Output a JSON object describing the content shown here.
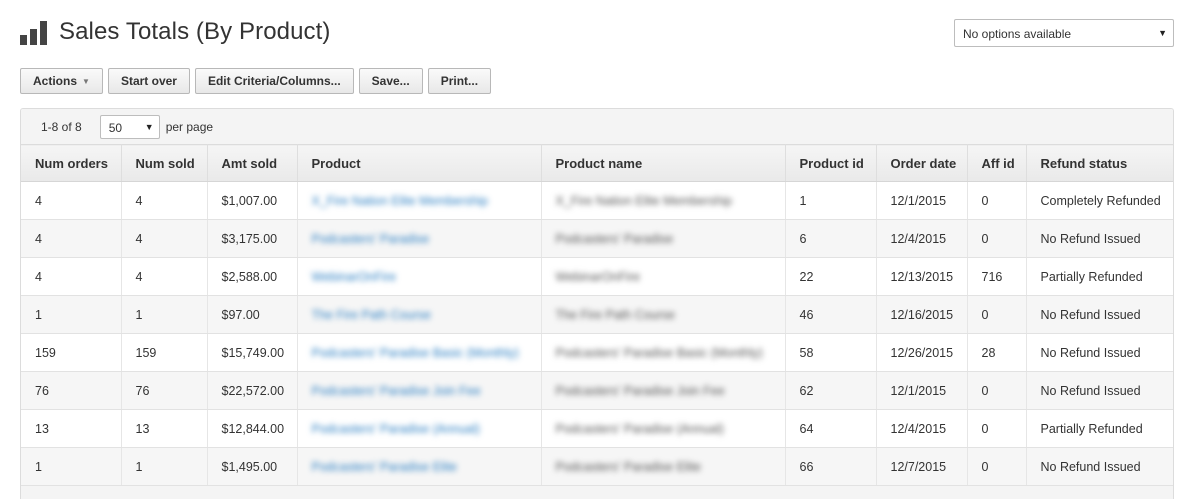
{
  "page": {
    "title": "Sales Totals (By Product)"
  },
  "header_select": {
    "value": "No options available"
  },
  "toolbar": {
    "actions": "Actions",
    "start_over": "Start over",
    "edit": "Edit Criteria/Columns...",
    "save": "Save...",
    "print": "Print..."
  },
  "pager": {
    "range": "1-8 of 8",
    "per_page_value": "50",
    "per_page_label": "per page"
  },
  "table": {
    "columns": [
      "Num orders",
      "Num sold",
      "Amt sold",
      "Product",
      "Product name",
      "Product id",
      "Order date",
      "Aff id",
      "Refund status"
    ],
    "rows": [
      [
        "4",
        "4",
        "$1,007.00",
        "X_Fire Nation Elite Membership",
        "X_Fire Nation Elite Membership",
        "1",
        "12/1/2015",
        "0",
        "Completely Refunded"
      ],
      [
        "4",
        "4",
        "$3,175.00",
        "Podcasters' Paradise",
        "Podcasters' Paradise",
        "6",
        "12/4/2015",
        "0",
        "No Refund Issued"
      ],
      [
        "4",
        "4",
        "$2,588.00",
        "WebinarOnFire",
        "WebinarOnFire",
        "22",
        "12/13/2015",
        "716",
        "Partially Refunded"
      ],
      [
        "1",
        "1",
        "$97.00",
        "The Fire Path Course",
        "The Fire Path Course",
        "46",
        "12/16/2015",
        "0",
        "No Refund Issued"
      ],
      [
        "159",
        "159",
        "$15,749.00",
        "Podcasters' Paradise Basic (Monthly)",
        "Podcasters' Paradise Basic (Monthly)",
        "58",
        "12/26/2015",
        "28",
        "No Refund Issued"
      ],
      [
        "76",
        "76",
        "$22,572.00",
        "Podcasters' Paradise Join Fee",
        "Podcasters' Paradise Join Fee",
        "62",
        "12/1/2015",
        "0",
        "No Refund Issued"
      ],
      [
        "13",
        "13",
        "$12,844.00",
        "Podcasters' Paradise (Annual)",
        "Podcasters' Paradise (Annual)",
        "64",
        "12/4/2015",
        "0",
        "Partially Refunded"
      ],
      [
        "1",
        "1",
        "$1,495.00",
        "Podcasters' Paradise Elite",
        "Podcasters' Paradise Elite",
        "66",
        "12/7/2015",
        "0",
        "No Refund Issued"
      ]
    ]
  }
}
